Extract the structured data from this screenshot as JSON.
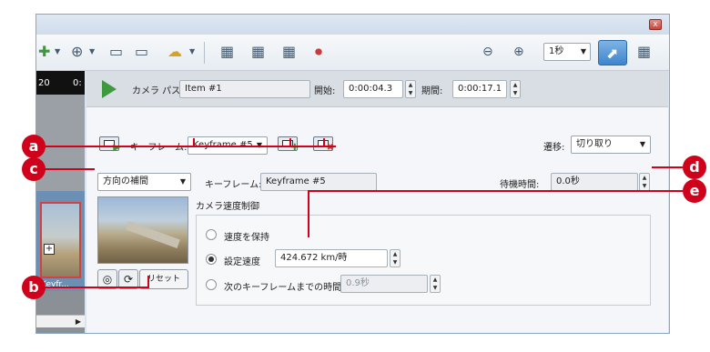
{
  "window": {
    "close_symbol": "x"
  },
  "toolbar": {
    "icons": [
      "add-point-icon",
      "zoom-add-icon",
      "add-overlay-icon",
      "add-overlay-icon",
      "weather-icon",
      "grid-view-icon",
      "add-grid-icon",
      "export-grid-icon",
      "record-icon",
      "zoom-out-icon",
      "zoom-in-icon",
      "dock-icon",
      "settings-icon"
    ],
    "interval_select": "1秒"
  },
  "timeline": {
    "ruler_labels": [
      "20",
      "0:"
    ],
    "track_item_label": "Keyfr...",
    "plus_symbol": "+"
  },
  "camera_bar": {
    "path_label": "カメラ パス:",
    "path_value": "Item #1",
    "start_label": "開始:",
    "start_value": "0:00:04.3",
    "duration_label": "期間:",
    "duration_value": "0:00:17.1"
  },
  "keyframe_row": {
    "label": "キーフレーム:",
    "selected": "Keyframe #5",
    "transition_label": "遷移:",
    "transition_value": "切り取り"
  },
  "settings_row": {
    "interpolation_value": "方向の補間",
    "keyframe_label": "キーフレーム:",
    "keyframe_name": "Keyframe #5",
    "wait_label": "待機時間:",
    "wait_value": "0.0秒"
  },
  "speed_group": {
    "title": "カメラ速度制御",
    "option_keep": "速度を保持",
    "option_set": "設定速度",
    "set_speed_value": "424.672 km/時",
    "option_time": "次のキーフレームまでの時間",
    "time_value": "0.9秒"
  },
  "buttons": {
    "reset": "リセット"
  },
  "callouts": {
    "a": "a",
    "b": "b",
    "c": "c",
    "d": "d",
    "e": "e"
  },
  "colors": {
    "callout": "#d0021b",
    "play": "#3f9a3f",
    "active_tool": "#3e84cc"
  }
}
